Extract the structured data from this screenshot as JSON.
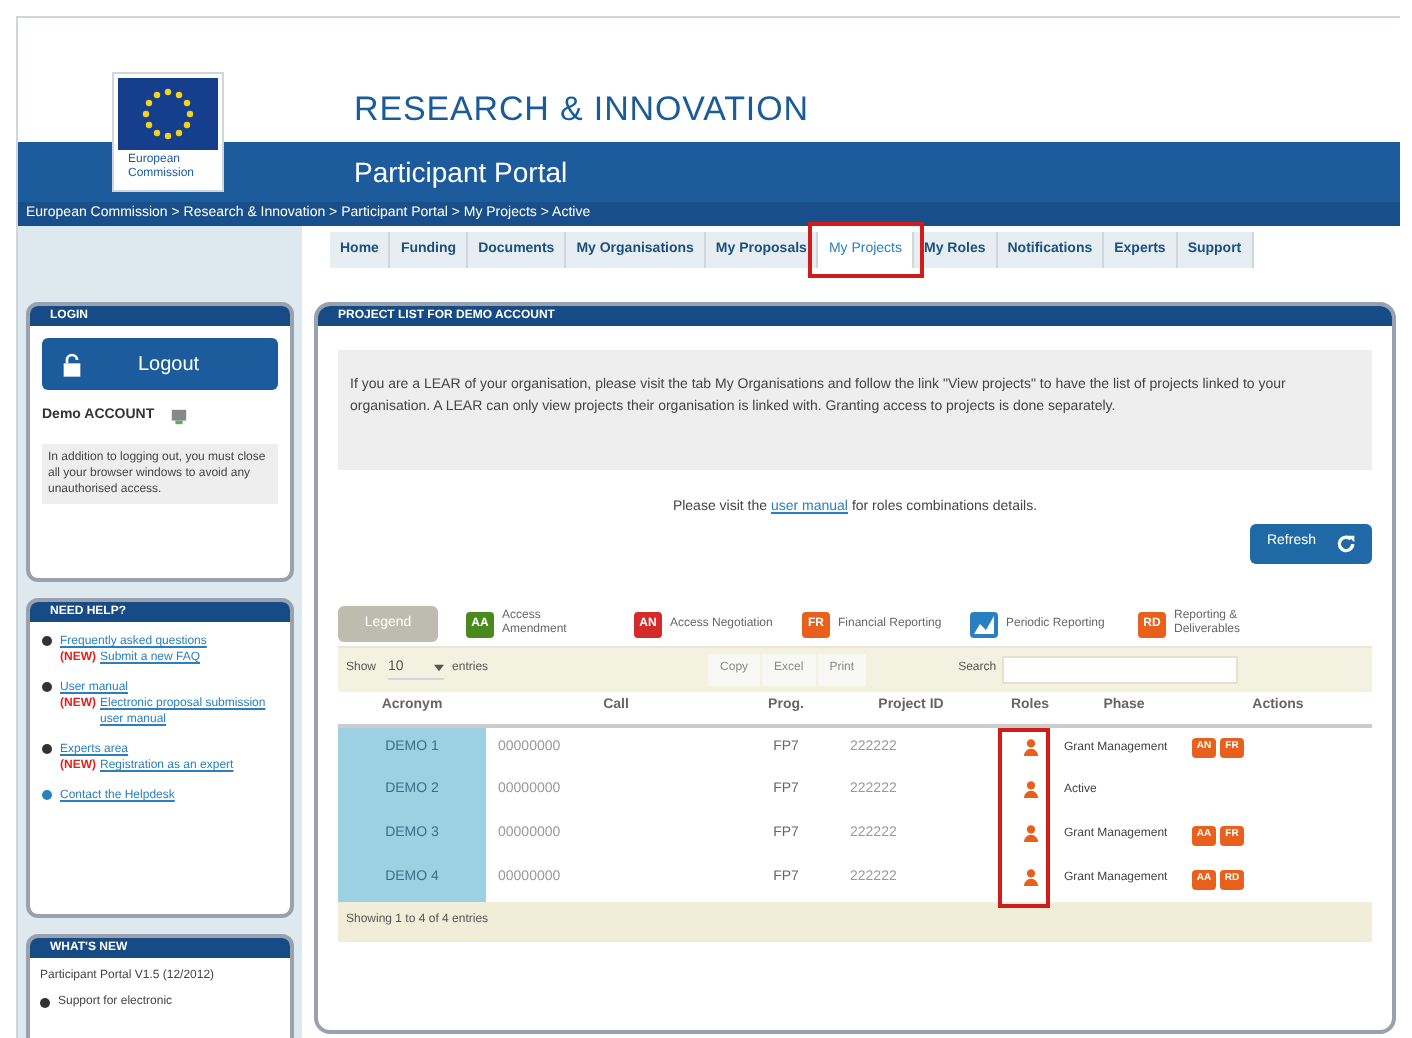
{
  "header": {
    "title": "RESEARCH & INNOVATION",
    "logo_caption": "European Commission",
    "subtitle": "Participant Portal",
    "breadcrumb": "European Commission > Research & Innovation > Participant Portal > My Projects > Active"
  },
  "tabs": [
    {
      "label": "Home",
      "selected": false,
      "highlighted": false
    },
    {
      "label": "Funding",
      "selected": false,
      "highlighted": false
    },
    {
      "label": "Documents",
      "selected": false,
      "highlighted": false
    },
    {
      "label": "My Organisations",
      "selected": false,
      "highlighted": false
    },
    {
      "label": "My Proposals",
      "selected": false,
      "highlighted": false
    },
    {
      "label": "My Projects",
      "selected": true,
      "highlighted": true
    },
    {
      "label": "My Roles",
      "selected": false,
      "highlighted": false
    },
    {
      "label": "Notifications",
      "selected": false,
      "highlighted": false
    },
    {
      "label": "Experts",
      "selected": false,
      "highlighted": false
    },
    {
      "label": "Support",
      "selected": false,
      "highlighted": false
    }
  ],
  "sidebar": {
    "login": {
      "title": "LOGIN",
      "button": "Logout",
      "account": "Demo ACCOUNT",
      "note": "In addition to logging out, you must close all your browser windows to avoid any unauthorised access."
    },
    "help": {
      "title": "NEED HELP?",
      "items": [
        {
          "link": "Frequently asked questions",
          "new_label": "(NEW)",
          "new_link": "Submit a new FAQ",
          "color": "#333333"
        },
        {
          "link": "User manual",
          "new_label": "(NEW)",
          "new_link": "Electronic proposal submission user manual",
          "color": "#333333"
        },
        {
          "link": "Experts area",
          "new_label": "(NEW)",
          "new_link": "Registration as an expert",
          "color": "#333333"
        },
        {
          "link": "Contact the Helpdesk",
          "color": "#2a7fc0"
        }
      ]
    },
    "news": {
      "title": "WHAT'S NEW",
      "version": "Participant Portal V1.5 (12/2012)",
      "item": "Support for electronic"
    }
  },
  "panel": {
    "title": "PROJECT LIST FOR DEMO ACCOUNT",
    "notice": "If you are a LEAR of your organisation, please visit the tab My Organisations and follow the link \"View projects\" to have the list of projects linked to your organisation. A LEAR can only view projects their organisation is linked with. Granting access to projects is done separately.",
    "manual_before": "Please visit the",
    "manual_link": "user manual",
    "manual_after": "for roles combinations details.",
    "refresh": "Refresh",
    "legend": [
      {
        "kind": "toggle",
        "label": "Legend"
      },
      {
        "kind": "badge",
        "code": "AA",
        "label": "Access Amendment",
        "color": "#4a8a1c"
      },
      {
        "kind": "badge",
        "code": "AN",
        "label": "Access Negotiation",
        "color": "#d42a2a"
      },
      {
        "kind": "badge",
        "code": "FR",
        "label": "Financial Reporting",
        "color": "#e8601c"
      },
      {
        "kind": "image",
        "label": "Periodic Reporting",
        "color": "#2a7fc0"
      },
      {
        "kind": "badge",
        "code": "RD",
        "label": "Reporting & Deliverables",
        "color": "#e8601c"
      }
    ]
  },
  "table": {
    "show_label": "Show",
    "page_size": "10",
    "entries_label": "entries",
    "tools": [
      "Copy",
      "Excel",
      "Print"
    ],
    "search_label": "Search",
    "columns": [
      "Acronym",
      "Call",
      "Prog.",
      "Project ID",
      "Roles",
      "Phase",
      "Actions"
    ],
    "roles_highlighted": true,
    "rows": [
      {
        "acronym": "DEMO 1",
        "call": "00000000",
        "prog": "FP7",
        "project_id": "222222",
        "phase": "Grant Management",
        "actions": [
          {
            "code": "AN",
            "color": "#e8601c"
          },
          {
            "code": "FR",
            "color": "#e8601c"
          }
        ]
      },
      {
        "acronym": "DEMO 2",
        "call": "00000000",
        "prog": "FP7",
        "project_id": "222222",
        "phase": "Active",
        "actions": []
      },
      {
        "acronym": "DEMO 3",
        "call": "00000000",
        "prog": "FP7",
        "project_id": "222222",
        "phase": "Grant Management",
        "actions": [
          {
            "code": "AA",
            "color": "#e8601c"
          },
          {
            "code": "FR",
            "color": "#e8601c"
          }
        ]
      },
      {
        "acronym": "DEMO 4",
        "call": "00000000",
        "prog": "FP7",
        "project_id": "222222",
        "phase": "Grant Management",
        "actions": [
          {
            "code": "AA",
            "color": "#e8601c"
          },
          {
            "code": "RD",
            "color": "#e8601c"
          }
        ]
      }
    ],
    "footer": "Showing 1 to 4 of 4 entries"
  }
}
